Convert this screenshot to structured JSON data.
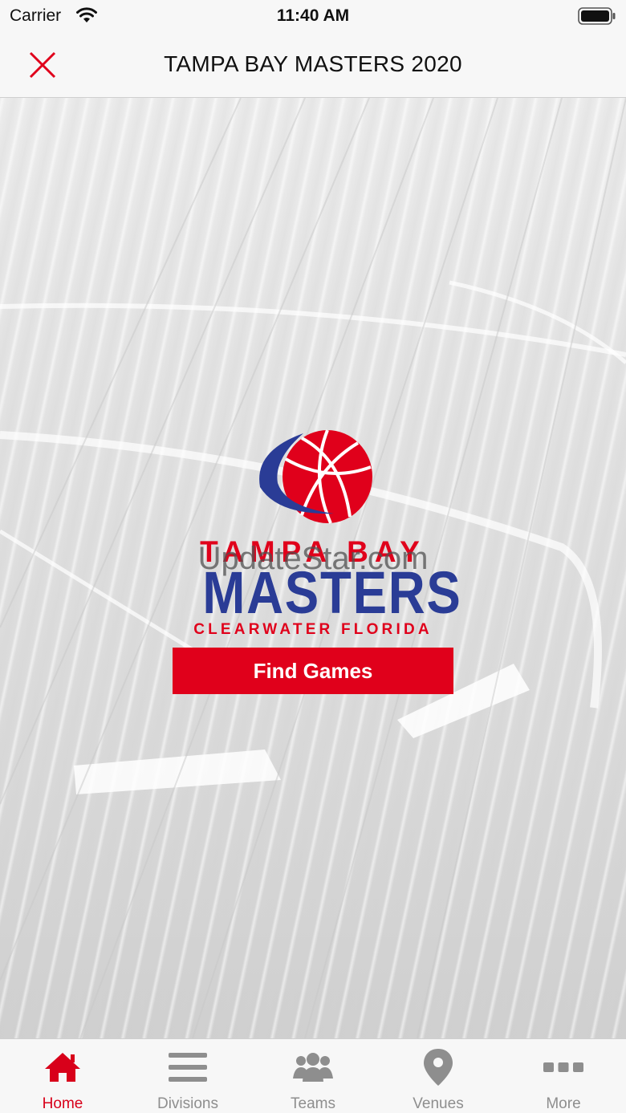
{
  "status_bar": {
    "carrier": "Carrier",
    "time": "11:40 AM"
  },
  "nav": {
    "title": "TAMPA BAY MASTERS 2020",
    "close_icon": "close-x-icon",
    "accent_color": "#e0001b"
  },
  "logo": {
    "line1": "TAMPA BAY",
    "line2": "MASTERS",
    "line3": "CLEARWATER FLORIDA",
    "watermark": "UpdateStar.com",
    "colors": {
      "red": "#e0001b",
      "blue": "#2a3c96"
    }
  },
  "main": {
    "find_games_label": "Find Games"
  },
  "tabs": [
    {
      "label": "Home",
      "icon": "home-icon",
      "active": true
    },
    {
      "label": "Divisions",
      "icon": "list-icon",
      "active": false
    },
    {
      "label": "Teams",
      "icon": "people-icon",
      "active": false
    },
    {
      "label": "Venues",
      "icon": "location-pin-icon",
      "active": false
    },
    {
      "label": "More",
      "icon": "more-dots-icon",
      "active": false
    }
  ]
}
